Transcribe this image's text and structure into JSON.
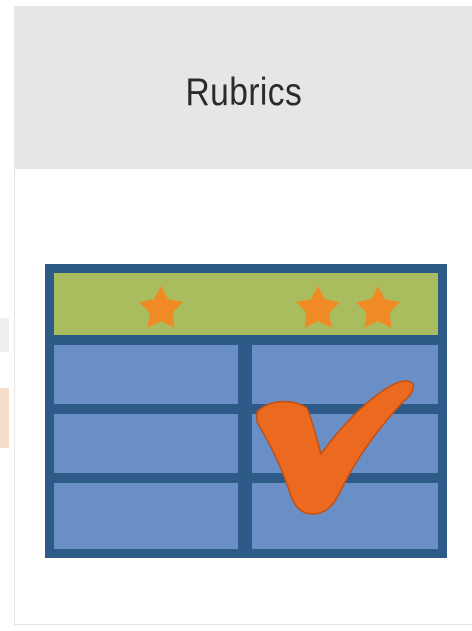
{
  "card": {
    "title": "Rubrics",
    "icon": "rubric-table-checkmark-icon"
  },
  "colors": {
    "header_bg": "#e6e6e6",
    "table_blue": "#6a8fc7",
    "table_border": "#2d5a87",
    "header_row_green": "#a9bd5e",
    "star_orange": "#f08a24",
    "check_orange": "#ec6a1f"
  }
}
